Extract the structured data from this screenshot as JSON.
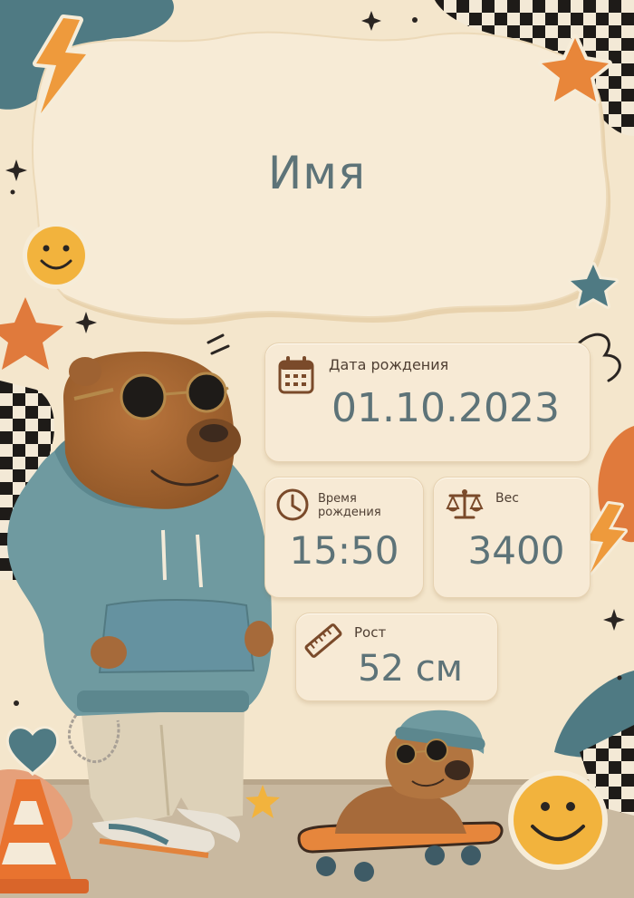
{
  "title": "Имя",
  "birth_date": {
    "label": "Дата рождения",
    "value": "01.10.2023",
    "icon": "calendar-icon"
  },
  "birth_time": {
    "label": "Время рождения",
    "value": "15:50",
    "icon": "clock-icon"
  },
  "weight": {
    "label": "Вес",
    "value": "3400",
    "icon": "scales-icon"
  },
  "height": {
    "label": "Рост",
    "value": "52 см",
    "icon": "ruler-icon"
  },
  "colors": {
    "background": "#f4e6cc",
    "accent_teal": "#4f7a83",
    "accent_orange": "#e8863a",
    "text_value": "#5d7378",
    "text_label": "#4f3f33",
    "card": "#f7ead5"
  }
}
